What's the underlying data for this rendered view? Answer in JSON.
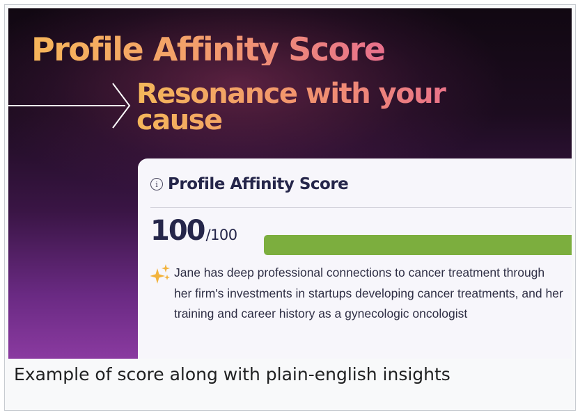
{
  "hero": {
    "title": "Profile Affinity Score",
    "subtitle": "Resonance with your cause"
  },
  "card": {
    "icon": "info-icon",
    "title": "Profile Affinity Score",
    "score": {
      "value": "100",
      "max_label": "/100",
      "fraction": 1.0,
      "bar_color": "#7cae3e"
    },
    "insight": {
      "icon": "sparkle-icon",
      "text": "Jane has deep professional connections to cancer treatment through her firm's investments in startups developing cancer treatments, and her training and career history as a gynecologic oncologist"
    }
  },
  "caption": "Example of score along with plain-english insights"
}
